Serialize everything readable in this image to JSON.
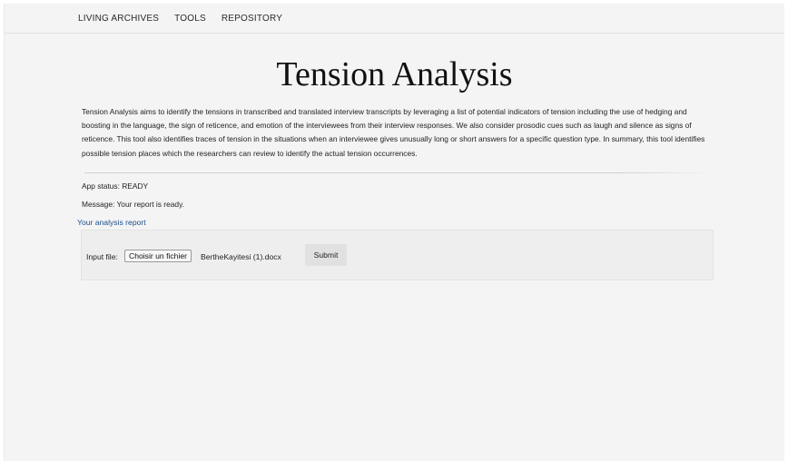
{
  "nav": {
    "items": [
      {
        "label": "LIVING ARCHIVES"
      },
      {
        "label": "TOOLS"
      },
      {
        "label": "REPOSITORY"
      }
    ]
  },
  "page": {
    "title": "Tension Analysis",
    "description": "Tension Analysis aims to identify the tensions in transcribed and translated interview transcripts by leveraging a list of potential indicators of tension including the use of hedging and boosting in the language, the sign of reticence, and emotion of the interviewees from their interview responses. We also consider prosodic cues such as laugh and silence as signs of reticence. This tool also identifies traces of tension in the situations when an interviewee gives unusually long or short answers for a specific question type. In summary, this tool identifies possible tension places which the researchers can review to identify the actual tension occurrences."
  },
  "status": {
    "app_status": "App status: READY",
    "message": "Message: Your report is ready.",
    "report_link": "Your analysis report"
  },
  "form": {
    "input_label": "Input file:",
    "file_button_label": "Choisir un fichier",
    "file_name": "BertheKayitesi (1).docx",
    "submit_label": "Submit"
  },
  "colors": {
    "link": "#1a4f8c",
    "background": "#f5f4f5"
  }
}
